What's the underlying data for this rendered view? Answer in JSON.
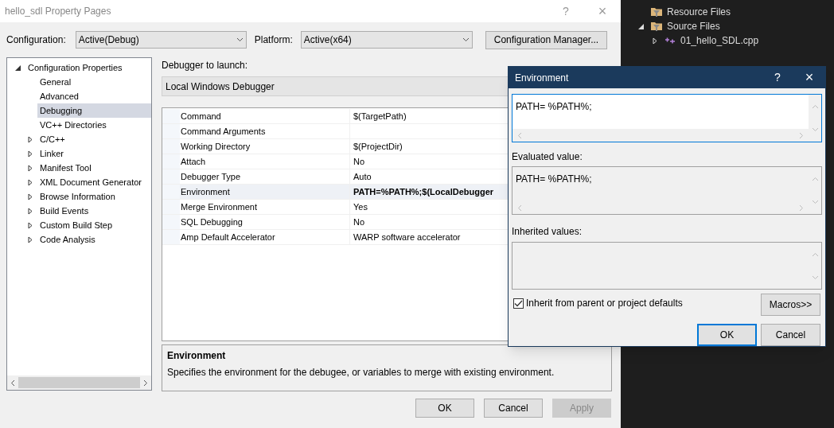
{
  "window": {
    "title": "hello_sdl Property Pages",
    "help": "?",
    "close": "×"
  },
  "configuration": {
    "label": "Configuration:",
    "value": "Active(Debug)"
  },
  "platform": {
    "label": "Platform:",
    "value": "Active(x64)"
  },
  "config_manager_button": "Configuration Manager...",
  "tree": [
    {
      "label": "Configuration Properties",
      "expanded": true,
      "selected": false,
      "children": [
        {
          "label": "General",
          "selected": false
        },
        {
          "label": "Advanced",
          "selected": false
        },
        {
          "label": "Debugging",
          "selected": true
        },
        {
          "label": "VC++ Directories",
          "selected": false
        },
        {
          "label": "C/C++",
          "selected": false,
          "expanded": false
        },
        {
          "label": "Linker",
          "selected": false,
          "expanded": false
        },
        {
          "label": "Manifest Tool",
          "selected": false,
          "expanded": false
        },
        {
          "label": "XML Document Generator",
          "selected": false,
          "expanded": false
        },
        {
          "label": "Browse Information",
          "selected": false,
          "expanded": false
        },
        {
          "label": "Build Events",
          "selected": false,
          "expanded": false
        },
        {
          "label": "Custom Build Step",
          "selected": false,
          "expanded": false
        },
        {
          "label": "Code Analysis",
          "selected": false,
          "expanded": false
        }
      ]
    }
  ],
  "debugger": {
    "label": "Debugger to launch:",
    "value": "Local Windows Debugger"
  },
  "properties": [
    {
      "name": "Command",
      "value": "$(TargetPath)",
      "selected": false,
      "modified": false
    },
    {
      "name": "Command Arguments",
      "selected": false
    },
    {
      "name": "Working Directory",
      "value": "$(ProjectDir)",
      "selected": false,
      "modified": false
    },
    {
      "name": "Attach",
      "value": "No",
      "selected": false,
      "modified": false
    },
    {
      "name": "Debugger Type",
      "value": "Auto",
      "selected": false,
      "modified": false
    },
    {
      "name": "Environment",
      "value": "PATH=%PATH%;$(LocalDebugger",
      "selected": true,
      "modified": true
    },
    {
      "name": "Merge Environment",
      "value": "Yes",
      "selected": false,
      "modified": false
    },
    {
      "name": "SQL Debugging",
      "value": "No",
      "selected": false,
      "modified": false
    },
    {
      "name": "Amp Default Accelerator",
      "value": "WARP software accelerator",
      "selected": false,
      "modified": false
    }
  ],
  "description": {
    "title": "Environment",
    "text": "Specifies the environment for the debugee, or variables to merge with existing environment."
  },
  "buttons": [
    {
      "label": "OK",
      "disabled": false
    },
    {
      "label": "Cancel",
      "disabled": false
    },
    {
      "label": "Apply",
      "disabled": true
    }
  ],
  "environment_dialog": {
    "title": "Environment",
    "help": "?",
    "close": "×",
    "value": "PATH= %PATH%;",
    "evaluated_label": "Evaluated value:",
    "evaluated_value": "PATH= %PATH%;",
    "inherited_label": "Inherited values:",
    "inherit_checkbox": {
      "label": "Inherit from parent or project defaults",
      "checked": true
    },
    "macros_button": "Macros>>",
    "buttons": [
      {
        "label": "OK",
        "focused": true
      },
      {
        "label": "Cancel",
        "focused": false
      }
    ]
  },
  "solution_explorer": [
    {
      "label": "Resource Files",
      "kind": "filter"
    },
    {
      "label": "Source Files",
      "kind": "filter",
      "expanded": true,
      "children": [
        {
          "label": "01_hello_SDL.cpp",
          "kind": "cpp",
          "expanded": false
        }
      ]
    }
  ]
}
